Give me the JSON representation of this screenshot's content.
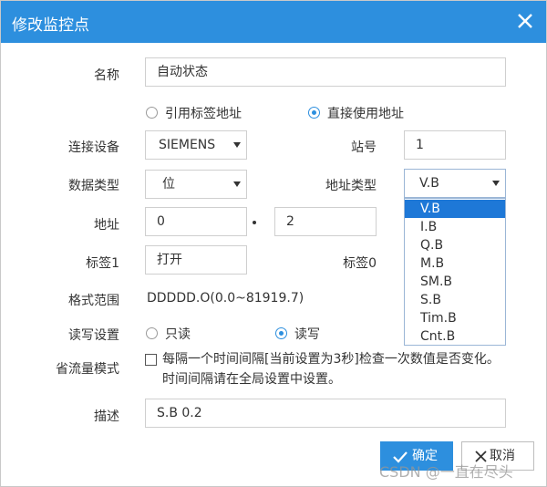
{
  "dialog": {
    "title": "修改监控点",
    "close_icon": "close-icon"
  },
  "form": {
    "name": {
      "label": "名称",
      "value": "自动状态"
    },
    "address_mode": {
      "options": [
        {
          "label": "引用标签地址",
          "checked": false
        },
        {
          "label": "直接使用地址",
          "checked": true
        }
      ]
    },
    "device": {
      "label": "连接设备",
      "value": "SIEMENS"
    },
    "station": {
      "label": "站号",
      "value": "1"
    },
    "data_type": {
      "label": "数据类型",
      "value": "位"
    },
    "address_type": {
      "label": "地址类型",
      "value": "V.B",
      "options": [
        "V.B",
        "I.B",
        "Q.B",
        "M.B",
        "SM.B",
        "S.B",
        "Tim.B",
        "Cnt.B"
      ],
      "highlighted": "V.B"
    },
    "address": {
      "label": "地址",
      "value1": "0",
      "value2": "2"
    },
    "tag1": {
      "label": "标签1",
      "value": "打开"
    },
    "tag0": {
      "label": "标签0"
    },
    "format": {
      "label": "格式范围",
      "value": "DDDDD.O(0.0~81919.7)"
    },
    "rw": {
      "label": "读写设置",
      "options": [
        {
          "label": "只读",
          "checked": false
        },
        {
          "label": "读写",
          "checked": true
        }
      ]
    },
    "saver": {
      "label": "省流量模式",
      "checked": false,
      "text": "每隔一个时间间隔[当前设置为3秒]检查一次数值是否变化。时间间隔请在全局设置中设置。"
    },
    "desc": {
      "label": "描述",
      "value": "S.B 0.2"
    }
  },
  "buttons": {
    "ok": "确定",
    "cancel": "取消"
  },
  "watermark": "CSDN @一直在尽头",
  "colors": {
    "accent": "#2d8fde",
    "selected": "#1e78d7"
  }
}
